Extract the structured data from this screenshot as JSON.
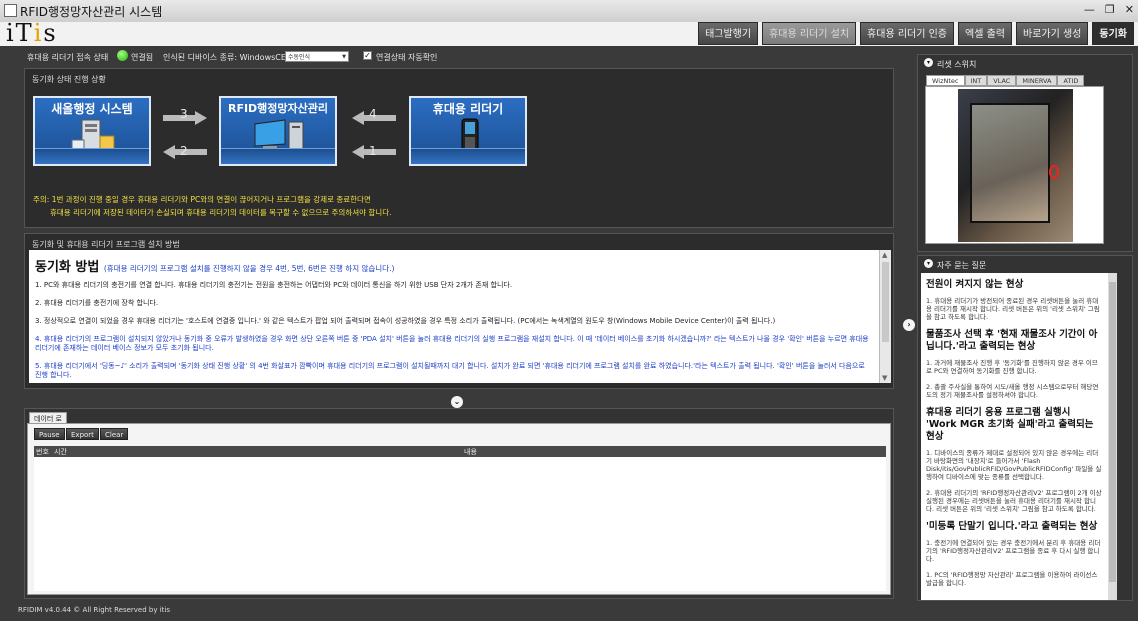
{
  "window": {
    "title": "RFID행정망자산관리 시스템",
    "minimize": "—",
    "restore": "❐",
    "close": "✕"
  },
  "logo": {
    "text_a": "iT",
    "text_b": "i",
    "text_c": "s"
  },
  "nav": {
    "tabs": [
      "태그발행기",
      "휴대용 리더기 설치",
      "휴대용 리더기 인증",
      "엑셀 출력",
      "바로가기 생성",
      "동기화"
    ]
  },
  "connection": {
    "status_label": "휴대용 리더기 접속 상태",
    "status_value": "연결됨",
    "device_label": "인식된 디바이스 종류: WindowsCE",
    "device_select": "수동인식",
    "auto_check_mark": "✓",
    "auto_check_label": "연결상태 자동확인"
  },
  "sync": {
    "title": "동기화 상태 진행 상황",
    "box1": "새올행정 시스템",
    "box2": "RFID행정망자산관리",
    "box3": "휴대용 리더기",
    "arrows": [
      "3",
      "2",
      "4",
      "1"
    ],
    "warning1": "주의: 1번 과정이 진행 중일 경우 휴대용 리더기와 PC와의 연결이 끊어지거나 프로그램을 강제로 종료한다면",
    "warning2": "휴대용 리더기에 저장된 데이터가 손실되며 휴대용 리더기의 데이터를 복구할 수 없으므로 주의하셔야 합니다."
  },
  "guide": {
    "panel_title": "동기화 및 휴대용 리더기 프로그램 설치 방법",
    "heading": "동기화 방법",
    "heading_sub": "(휴대용 리더기의 프로그램 설치를 진행하지 않을 경우 4번, 5번, 6번은 진행 하지 않습니다.)",
    "p1": "1. PC와 휴대용 리더기의 충전기를 연결 합니다. 휴대용 리더기의 충전기는 전원을 충전하는 어댑터와 PC와 데이터 통신을 하기 위한 USB 단자 2개가 존재 합니다.",
    "p2": "2. 휴대용 리더기를 충전기에 장착 합니다.",
    "p3": "3. 정상적으로 연결이 되었을 경우 휴대용 리더기는 '호스트에 연결중 입니다.' 와 같은 텍스트가 팝업 되어 출력되며 접속이 성공하였을 경우 특정 소리가 출력됩니다.  (PC에서는 녹색계열의 원도우 창(Windows Mobile Device Center)이 출력 됩니다.)",
    "p4": "4. 휴대용 리더기의 프로그램이 설치되지 않았거나 동기화 중 오류가 발생하였을 경우 화면 상단 오른쪽 버튼 중 'PDA 설치' 버튼을 눌러 휴대용 리더기의 실행 프로그램을 재설치 합니다. 이 때 '데이터 베이스를 초기화 하시겠습니까?' 라는 텍스트가 나올 경우 '확인' 버튼을 누르면 휴대용 리더기에 존재하는 데이터 베이스 정보가 모두 초기화 됩니다.",
    "p5": "5. 휴대용 리더기에서 '딩동~♪' 소리가 출력되며 '동기화 상태 진행 상황' 의 4번 화살표가 깜빡이며 휴대용 리더기의 프로그램이 설치될때까지 대기 합니다. 설치가 완료 되면 '휴대용 리더기에 프로그램 설치를 완료 하였습니다.'라는 텍스트가 출력 됩니다. '확인' 버튼을 눌러서 다음으로 진행 합니다."
  },
  "log": {
    "tab": "데이터 로그",
    "buttons": [
      "Pause",
      "Export",
      "Clear"
    ],
    "columns": [
      "번호",
      "시간",
      "내용"
    ]
  },
  "right": {
    "reset_title": "리셋 스위치",
    "reset_tabs": [
      "WizNtec",
      "INT",
      "VLAC",
      "MINERVA",
      "ATID"
    ],
    "faq_title": "자주 묻는 질문",
    "faq": [
      {
        "q": "전원이 켜지지 않는 현상",
        "a": [
          "1. 휴대용 리더기가 방전되어 종료된 경우 리셋버튼을 눌러 휴대용 리더기를 재시작 합니다. 리셋 버튼은 위의 '리셋 스위치' 그림을 참고 하도록 합니다."
        ]
      },
      {
        "q": "물품조사 선택 후 '현재 재물조사 기간이 아닙니다.'라고 출력되는 현상",
        "a": [
          "1. 과거에 재물조사 진행 후 '동기화'를 진행하지 않은 경우 이므로 PC와 연결하여 동기화를 진행 합니다.",
          "2. 총괄 주사실을 통하여 시도/새올 행정 시스템으로부터 해당연도의 정기 재물조사를 설정하셔야 합니다."
        ]
      },
      {
        "q": "휴대용 리더기 응용 프로그램 실행시 'Work MGR 초기화 실패'라고 출력되는 현상",
        "a": [
          "1. 디바이스의 종류가 제대로 설정되어 있지 않은 경우에는 리더기 바탕화면의 '내장치'로 들어가서 'Flash Disk/itis/GovPublicRFID/GovPublicRFIDConfig' 파일을 실행하여 디바이스에 맞는 종류를 선택합니다.",
          "2. 휴대용 리더기의 'RFID행정자산관리V2' 프로그램이 2개 이상 실행된 경우에는 리셋버튼을 눌러 휴대용 리더기를 재시작 합니다. 리셋 버튼은 위의 '리셋 스위치' 그림을 참고 하도록 합니다."
        ]
      },
      {
        "q": "'미등록 단말기 입니다.'라고 출력되는 현상",
        "a": [
          "1. 충전기에 연결되어 있는 경우 충전기에서 분리 후 휴대용 리더기의 'RFID행정자산관리V2' 프로그램을 종료 후 다시 실행 합니다.",
          "1. PC의 'RFID행정망 자산관리' 프로그램을 이용하여 라이선스 발급을 합니다."
        ]
      }
    ]
  },
  "footer": "RFIDIM v4.0.44 © All Right Reserved by itis"
}
